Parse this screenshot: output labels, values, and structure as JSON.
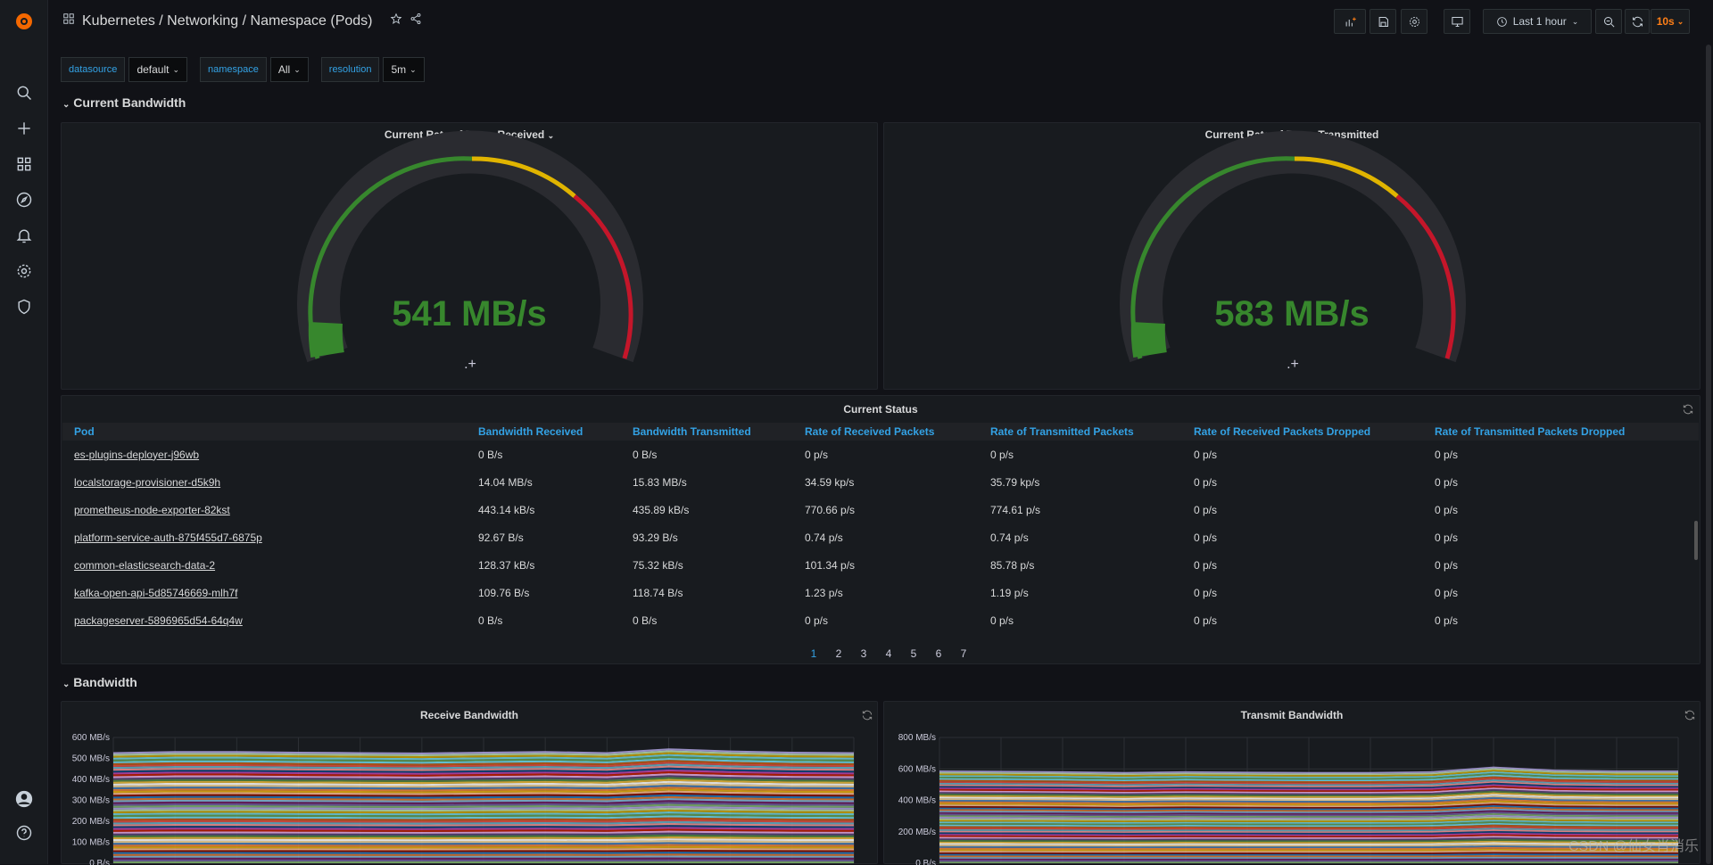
{
  "breadcrumb": "Kubernetes / Networking / Namespace (Pods)",
  "toolbar": {
    "time_range": "Last 1 hour",
    "refresh": "10s"
  },
  "variables": [
    {
      "label": "datasource",
      "value": "default"
    },
    {
      "label": "namespace",
      "value": "All"
    },
    {
      "label": "resolution",
      "value": "5m"
    }
  ],
  "rows": {
    "current_bandwidth": "Current Bandwidth",
    "bandwidth": "Bandwidth"
  },
  "gauges": [
    {
      "title": "Current Rate of Bytes Received",
      "value": "541 MB/s",
      "fraction": 0.06
    },
    {
      "title": "Current Rate of Bytes Transmitted",
      "value": "583 MB/s",
      "fraction": 0.06
    }
  ],
  "status_table": {
    "title": "Current Status",
    "columns": [
      "Pod",
      "Bandwidth Received",
      "Bandwidth Transmitted",
      "Rate of Received Packets",
      "Rate of Transmitted Packets",
      "Rate of Received Packets Dropped",
      "Rate of Transmitted Packets Dropped"
    ],
    "rows": [
      [
        "es-plugins-deployer-j96wb",
        "0 B/s",
        "0 B/s",
        "0 p/s",
        "0 p/s",
        "0 p/s",
        "0 p/s"
      ],
      [
        "localstorage-provisioner-d5k9h",
        "14.04 MB/s",
        "15.83 MB/s",
        "34.59 kp/s",
        "35.79 kp/s",
        "0 p/s",
        "0 p/s"
      ],
      [
        "prometheus-node-exporter-82kst",
        "443.14 kB/s",
        "435.89 kB/s",
        "770.66 p/s",
        "774.61 p/s",
        "0 p/s",
        "0 p/s"
      ],
      [
        "platform-service-auth-875f455d7-6875p",
        "92.67 B/s",
        "93.29 B/s",
        "0.74 p/s",
        "0.74 p/s",
        "0 p/s",
        "0 p/s"
      ],
      [
        "common-elasticsearch-data-2",
        "128.37 kB/s",
        "75.32 kB/s",
        "101.34 p/s",
        "85.78 p/s",
        "0 p/s",
        "0 p/s"
      ],
      [
        "kafka-open-api-5d85746669-mlh7f",
        "109.76 B/s",
        "118.74 B/s",
        "1.23 p/s",
        "1.19 p/s",
        "0 p/s",
        "0 p/s"
      ],
      [
        "packageserver-5896965d54-64q4w",
        "0 B/s",
        "0 B/s",
        "0 p/s",
        "0 p/s",
        "0 p/s",
        "0 p/s"
      ]
    ],
    "pages": [
      "1",
      "2",
      "3",
      "4",
      "5",
      "6",
      "7"
    ]
  },
  "chart_data": [
    {
      "type": "area",
      "title": "Receive Bandwidth",
      "yticks": [
        "600 MB/s",
        "500 MB/s",
        "400 MB/s",
        "300 MB/s",
        "200 MB/s",
        "100 MB/s",
        "0 B/s"
      ],
      "ylim": [
        0,
        600
      ],
      "total": [
        530,
        535,
        535,
        532,
        530,
        528,
        532,
        535,
        530,
        548,
        538,
        532,
        530
      ],
      "grid": true
    },
    {
      "type": "area",
      "title": "Transmit Bandwidth",
      "yticks": [
        "800 MB/s",
        "600 MB/s",
        "400 MB/s",
        "200 MB/s",
        "0 B/s"
      ],
      "ylim": [
        0,
        800
      ],
      "total": [
        590,
        588,
        585,
        580,
        585,
        582,
        580,
        580,
        585,
        615,
        595,
        590,
        590
      ],
      "grid": true
    }
  ],
  "watermark": "CSDN @仙女肖消乐",
  "colors": {
    "accent": "#33a2e5",
    "green": "#37872d",
    "yellow": "#e0b400",
    "red": "#c4162a",
    "refresh_active": "#ff7f17"
  }
}
